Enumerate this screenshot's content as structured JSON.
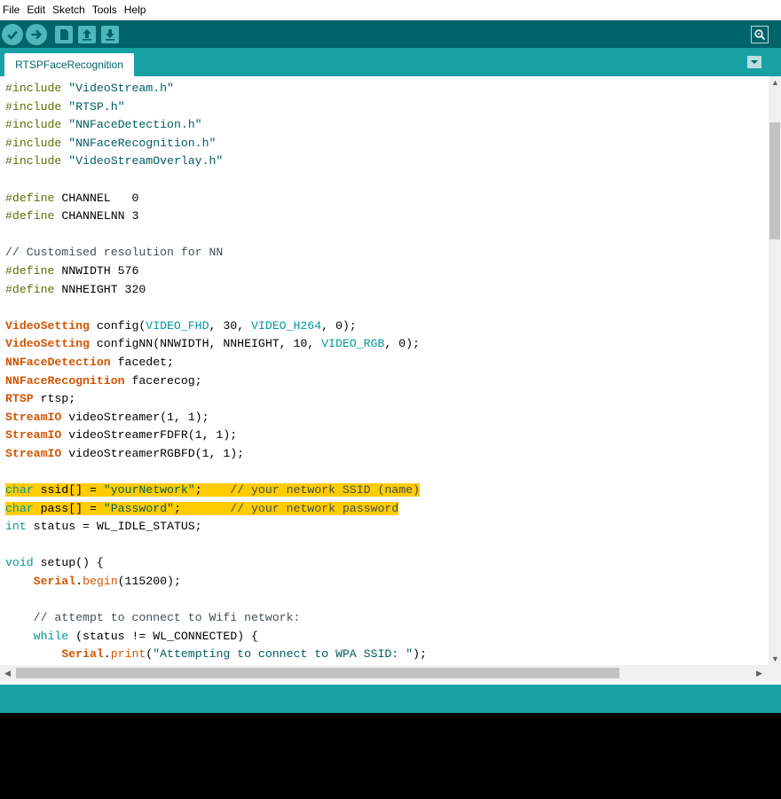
{
  "menu": {
    "items": [
      "File",
      "Edit",
      "Sketch",
      "Tools",
      "Help"
    ]
  },
  "toolbar": {
    "buttons": [
      "verify-icon",
      "upload-icon",
      "new-icon",
      "open-icon",
      "save-icon"
    ],
    "serial_monitor": "serial-monitor-icon"
  },
  "tabs": {
    "active": "RTSPFaceRecognition",
    "menu_icon": "chevron-down-icon"
  },
  "colors": {
    "toolbar_bg": "#006468",
    "tab_bar_bg": "#17a1a5",
    "highlight": "#ffcc00"
  },
  "code": {
    "lines": [
      "#include \"VideoStream.h\"",
      "#include \"RTSP.h\"",
      "#include \"NNFaceDetection.h\"",
      "#include \"NNFaceRecognition.h\"",
      "#include \"VideoStreamOverlay.h\"",
      "",
      "#define CHANNEL   0",
      "#define CHANNELNN 3",
      "",
      "// Customised resolution for NN",
      "#define NNWIDTH 576",
      "#define NNHEIGHT 320",
      "",
      "VideoSetting config(VIDEO_FHD, 30, VIDEO_H264, 0);",
      "VideoSetting configNN(NNWIDTH, NNHEIGHT, 10, VIDEO_RGB, 0);",
      "NNFaceDetection facedet;",
      "NNFaceRecognition facerecog;",
      "RTSP rtsp;",
      "StreamIO videoStreamer(1, 1);",
      "StreamIO videoStreamerFDFR(1, 1);",
      "StreamIO videoStreamerRGBFD(1, 1);",
      "",
      "char ssid[] = \"yourNetwork\";    // your network SSID (name)",
      "char pass[] = \"Password\";       // your network password",
      "int status = WL_IDLE_STATUS;",
      "",
      "void setup() {",
      "    Serial.begin(115200);",
      "",
      "    // attempt to connect to Wifi network:",
      "    while (status != WL_CONNECTED) {",
      "        Serial.print(\"Attempting to connect to WPA SSID: \");"
    ],
    "highlighted_lines": [
      22,
      23
    ]
  }
}
